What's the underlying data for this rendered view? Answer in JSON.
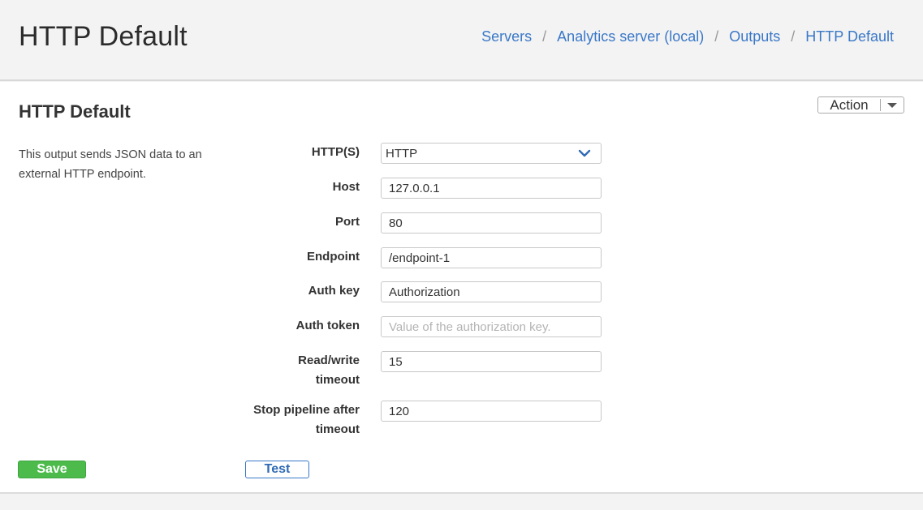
{
  "header": {
    "title": "HTTP Default",
    "breadcrumb": [
      "Servers",
      "Analytics server (local)",
      "Outputs",
      "HTTP Default"
    ],
    "separator": "/"
  },
  "card": {
    "title": "HTTP Default",
    "action_label": "Action",
    "description": "This output sends JSON data to an external HTTP endpoint."
  },
  "form": {
    "protocol": {
      "label": "HTTP(S)",
      "value": "HTTP"
    },
    "host": {
      "label": "Host",
      "value": "127.0.0.1"
    },
    "port": {
      "label": "Port",
      "value": "80"
    },
    "endpoint": {
      "label": "Endpoint",
      "value": "/endpoint-1"
    },
    "auth_key": {
      "label": "Auth key",
      "value": "Authorization"
    },
    "auth_token": {
      "label": "Auth token",
      "value": "",
      "placeholder": "Value of the authorization key."
    },
    "rw_timeout": {
      "label_line1": "Read/write",
      "label_line2": "timeout",
      "value": "15"
    },
    "stop_pipeline": {
      "label_line1": "Stop pipeline after",
      "label_line2": "timeout",
      "value": "120"
    }
  },
  "buttons": {
    "save": "Save",
    "test": "Test"
  },
  "colors": {
    "link": "#3a78c8",
    "save": "#4cbb4c",
    "test_border": "#3a78c8"
  },
  "icons": {
    "select": "chevron-down-icon",
    "action": "caret-down-icon"
  }
}
